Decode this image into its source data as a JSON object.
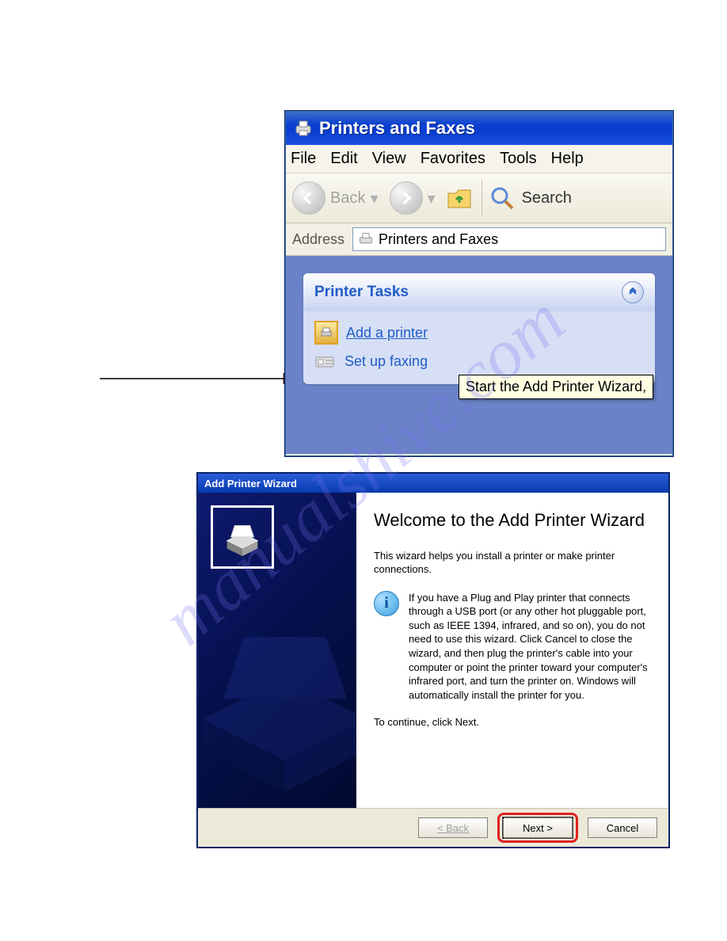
{
  "explorer": {
    "title": "Printers and Faxes",
    "menu": [
      "File",
      "Edit",
      "View",
      "Favorites",
      "Tools",
      "Help"
    ],
    "toolbar": {
      "back": "Back",
      "search": "Search"
    },
    "address": {
      "label": "Address",
      "value": "Printers and Faxes"
    },
    "tasks": {
      "heading": "Printer Tasks",
      "add": "Add a printer",
      "fax": "Set up faxing"
    },
    "tooltip": "Start the Add Printer Wizard,"
  },
  "wizard": {
    "title": "Add Printer Wizard",
    "heading": "Welcome to the Add Printer Wizard",
    "intro": "This wizard helps you install a printer or make printer connections.",
    "info": "If you have a Plug and Play printer that connects through a USB port (or any other hot pluggable port, such as IEEE 1394, infrared, and so on), you do not need to use this wizard. Click Cancel to close the wizard, and then plug the printer's cable into your computer or point the printer toward your computer's infrared port, and turn the printer on. Windows will automatically install the printer for you.",
    "continue": "To continue, click Next.",
    "buttons": {
      "back": "< Back",
      "next": "Next >",
      "cancel": "Cancel"
    }
  },
  "watermark": "manualshive.com"
}
